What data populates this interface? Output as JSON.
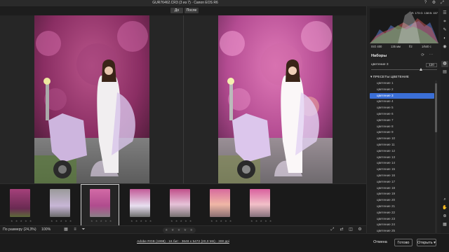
{
  "window": {
    "title": "GUR76462.CR3 (3 из 7)  ·  Canon EOS R6"
  },
  "compare": {
    "before_label": "До",
    "after_label": "После"
  },
  "filmstrip": {
    "count": 7,
    "selected_index": 2,
    "stars": "★ ★ ★ ★ ★"
  },
  "statusbar": {
    "zoom_label": "По размеру (24,3%)",
    "zoom_percent": "100%",
    "rating": "★ ★ ★ ★ ★"
  },
  "footer": {
    "meta": "Adobe RGB (1998) - 16 бит - 3648 x 5472 (20,0 Мп) - 300 ppi",
    "cancel_label": "Отмена",
    "done_label": "Готово",
    "open_label": "Открыть"
  },
  "histogram": {
    "rgb_readout": "R: 173  G: 138  B: 157",
    "iso": "ISO 400",
    "focal": "135 мм",
    "aperture": "f/2",
    "shutter": "1/640 с"
  },
  "presets": {
    "panel_title": "Наборы",
    "active_preset": "цветение 3",
    "amount": "120",
    "amount_fraction": 0.75,
    "group_title": "ПРЕСЕТЫ ЦВЕТЕНИЕ",
    "items": [
      "цветение 1",
      "цветение 2",
      "цветение 3",
      "цветение 4",
      "цветение 5",
      "цветение 6",
      "цветение 7",
      "цветение 8",
      "цветение 9",
      "цветение 10",
      "цветение 11",
      "цветение 12",
      "цветение 13",
      "цветение 14",
      "цветение 15",
      "цветение 16",
      "цветение 17",
      "цветение 18",
      "цветение 19",
      "цветение 20",
      "цветение 21",
      "цветение 22",
      "цветение 23",
      "цветение 24",
      "цветение 25"
    ],
    "selected_index": 2
  },
  "colors": {
    "accent": "#3b6fd6",
    "blossom": "#c8408f",
    "panel": "#222222"
  }
}
